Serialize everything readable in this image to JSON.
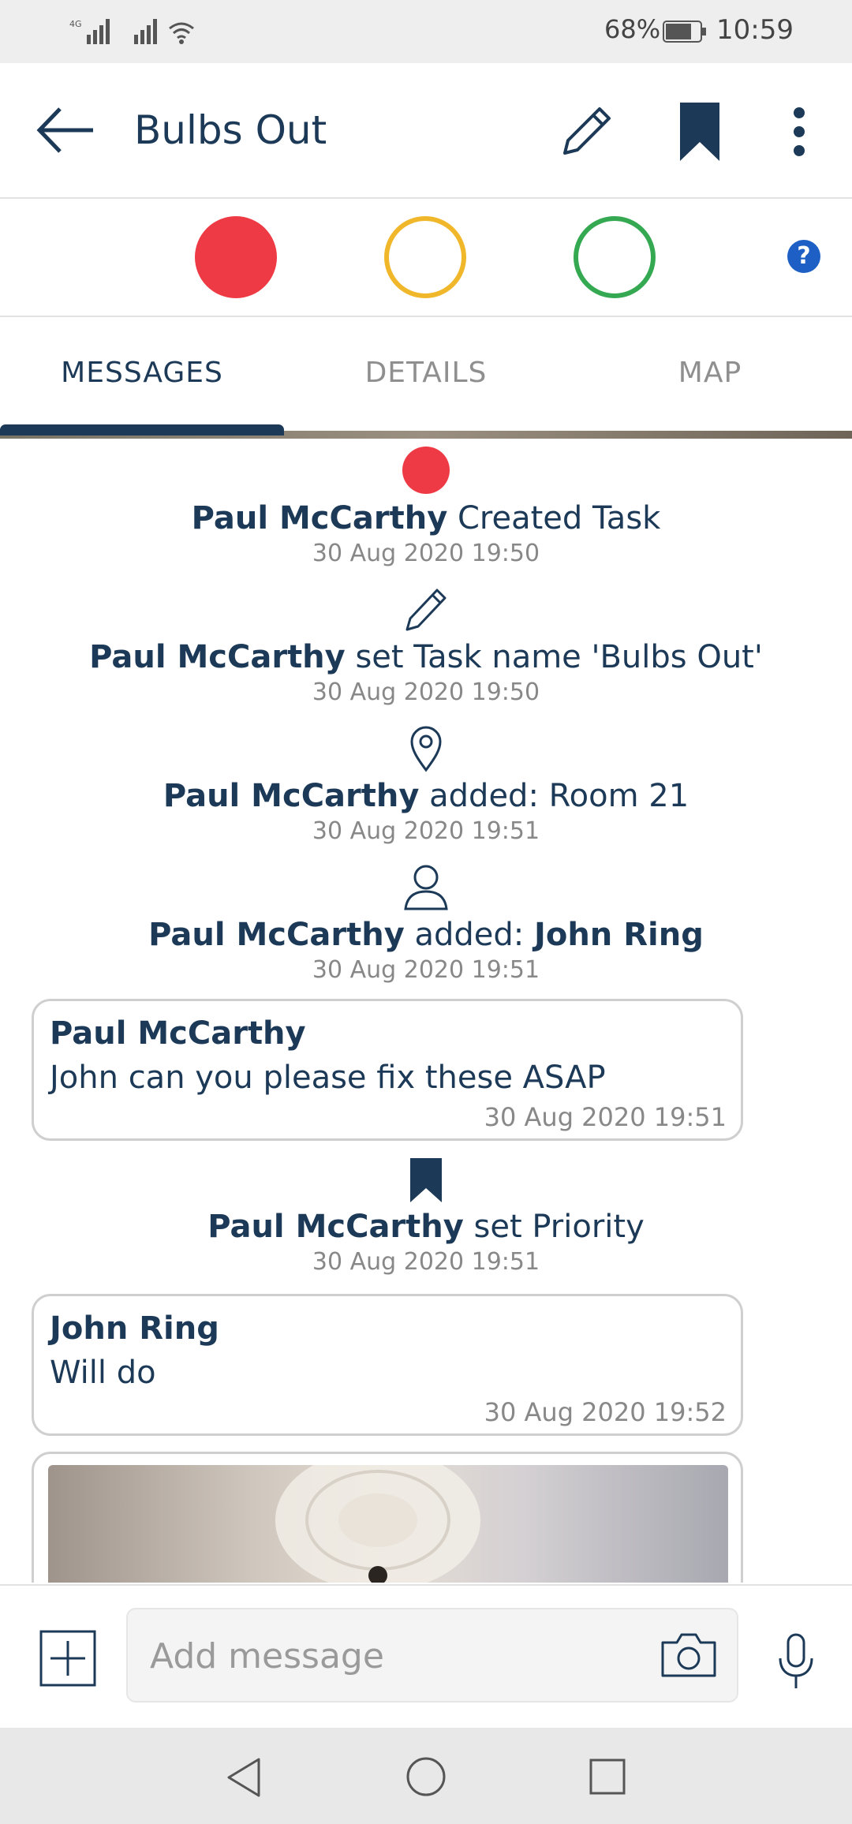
{
  "status_bar": {
    "network": "4G",
    "battery_percent": "68%",
    "time": "10:59"
  },
  "header": {
    "title": "Bulbs Out",
    "icons": [
      "back-arrow-icon",
      "pencil-icon",
      "bookmark-icon",
      "more-vertical-icon"
    ]
  },
  "status_selector": {
    "options": [
      {
        "name": "red",
        "color": "#ee3a44",
        "selected": true
      },
      {
        "name": "amber",
        "color": "#f1b72b",
        "selected": false
      },
      {
        "name": "green",
        "color": "#35a952",
        "selected": false
      }
    ],
    "help_label": "?"
  },
  "tabs": [
    {
      "label": "MESSAGES",
      "active": true
    },
    {
      "label": "DETAILS",
      "active": false
    },
    {
      "label": "MAP",
      "active": false
    }
  ],
  "feed": {
    "events": [
      {
        "author": "Paul McCarthy",
        "action": " Created Task",
        "time": "30 Aug 2020 19:50",
        "icon": "red-status-dot"
      },
      {
        "author": "Paul McCarthy",
        "action": " set Task name 'Bulbs Out'",
        "time": "30 Aug 2020 19:50",
        "icon": "pencil-icon"
      },
      {
        "author": "Paul McCarthy",
        "action": " added: Room 21",
        "time": "30 Aug 2020 19:51",
        "icon": "location-pin-icon"
      },
      {
        "author": "Paul McCarthy",
        "action": " added: ",
        "target": "John Ring",
        "time": "30 Aug 2020 19:51",
        "icon": "user-icon"
      },
      {
        "author": "Paul McCarthy",
        "action": " set Priority",
        "time": "30 Aug 2020 19:51",
        "icon": "bookmark-icon"
      }
    ],
    "messages": [
      {
        "author": "Paul McCarthy",
        "text": "John can you please fix these ASAP",
        "time": "30 Aug 2020 19:51"
      },
      {
        "author": "John Ring",
        "text": "Will do",
        "time": "30 Aug 2020 19:52"
      }
    ]
  },
  "composer": {
    "placeholder": "Add message",
    "icons": [
      "add-square-icon",
      "camera-icon",
      "microphone-icon"
    ]
  },
  "colors": {
    "primary": "#1c3a57",
    "status_red": "#ee3a44",
    "status_amber": "#f1b72b",
    "status_green": "#35a952",
    "help_blue": "#1d5fc4"
  }
}
